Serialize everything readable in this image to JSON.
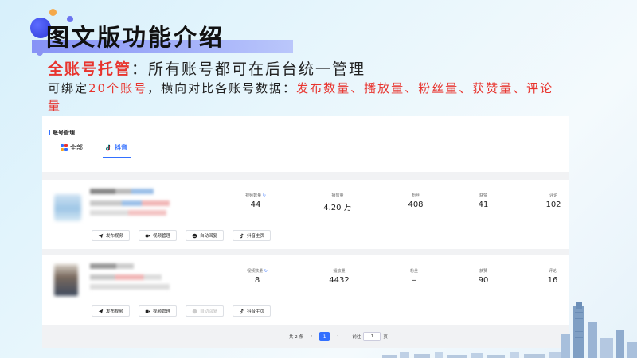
{
  "slide": {
    "title": "图文版功能介绍",
    "headline_highlight": "全账号托管",
    "headline_colon": "：",
    "headline_rest": "所有账号都可在后台统一管理",
    "desc_prefix": "可绑定",
    "desc_count": "20个账号",
    "desc_middle": "，横向对比各账号数据：",
    "desc_metrics": "发布数量、播放量、粉丝量、获赞量、评论量"
  },
  "panel": {
    "title": "账号管理",
    "tabs": [
      {
        "label": "全部"
      },
      {
        "label": "抖音"
      }
    ],
    "stat_labels": {
      "videos": "视频数量",
      "plays": "播放量",
      "fans": "粉丝",
      "likes": "获赞",
      "comments": "评论"
    },
    "accounts": [
      {
        "videos": "44",
        "plays": "4.20 万",
        "fans": "408",
        "likes": "41",
        "comments": "102"
      },
      {
        "videos": "8",
        "plays": "4432",
        "fans": "–",
        "likes": "90",
        "comments": "16"
      }
    ],
    "actions": {
      "publish": "发布视频",
      "manage": "视频管理",
      "auto_reply": "自动回复",
      "homepage": "抖音主页"
    },
    "pagination": {
      "total": "共 2 条",
      "current": "1",
      "goto_label": "前往",
      "goto_value": "1",
      "page_suffix": "页"
    }
  },
  "colors": {
    "accent": "#3370ff",
    "highlight_red": "#e8342e",
    "title_underline": "#7b84f3"
  },
  "icons": {
    "refresh": "refresh-icon",
    "publish": "paper-plane-icon",
    "manage": "video-camera-icon",
    "auto_reply": "chat-bubble-icon",
    "homepage": "douyin-icon"
  }
}
